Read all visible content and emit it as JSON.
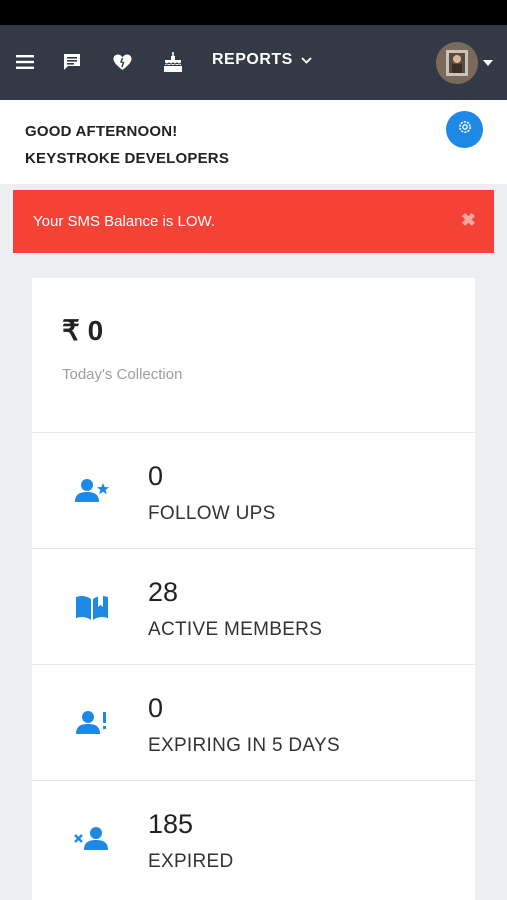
{
  "nav": {
    "reports_label": "REPORTS",
    "icons": [
      "menu-icon",
      "message-icon",
      "heart-icon",
      "birthday-cake-icon",
      "chevron-down-icon"
    ]
  },
  "greeting": {
    "line1": "GOOD AFTERNOON!",
    "line2": "KEYSTROKE DEVELOPERS"
  },
  "alert": {
    "message": "Your SMS Balance is LOW.",
    "close": "✖"
  },
  "collection": {
    "amount": "₹ 0",
    "label": "Today's Collection"
  },
  "stats": [
    {
      "value": "0",
      "label": "FOLLOW UPS",
      "icon": "user-star-icon"
    },
    {
      "value": "28",
      "label": "ACTIVE MEMBERS",
      "icon": "open-book-icon"
    },
    {
      "value": "0",
      "label": "EXPIRING IN 5 DAYS",
      "icon": "user-alert-icon"
    },
    {
      "value": "185",
      "label": "EXPIRED",
      "icon": "user-remove-icon"
    }
  ],
  "colors": {
    "navbar": "#343a45",
    "accent": "#1e88e5",
    "alert": "#f44336"
  }
}
